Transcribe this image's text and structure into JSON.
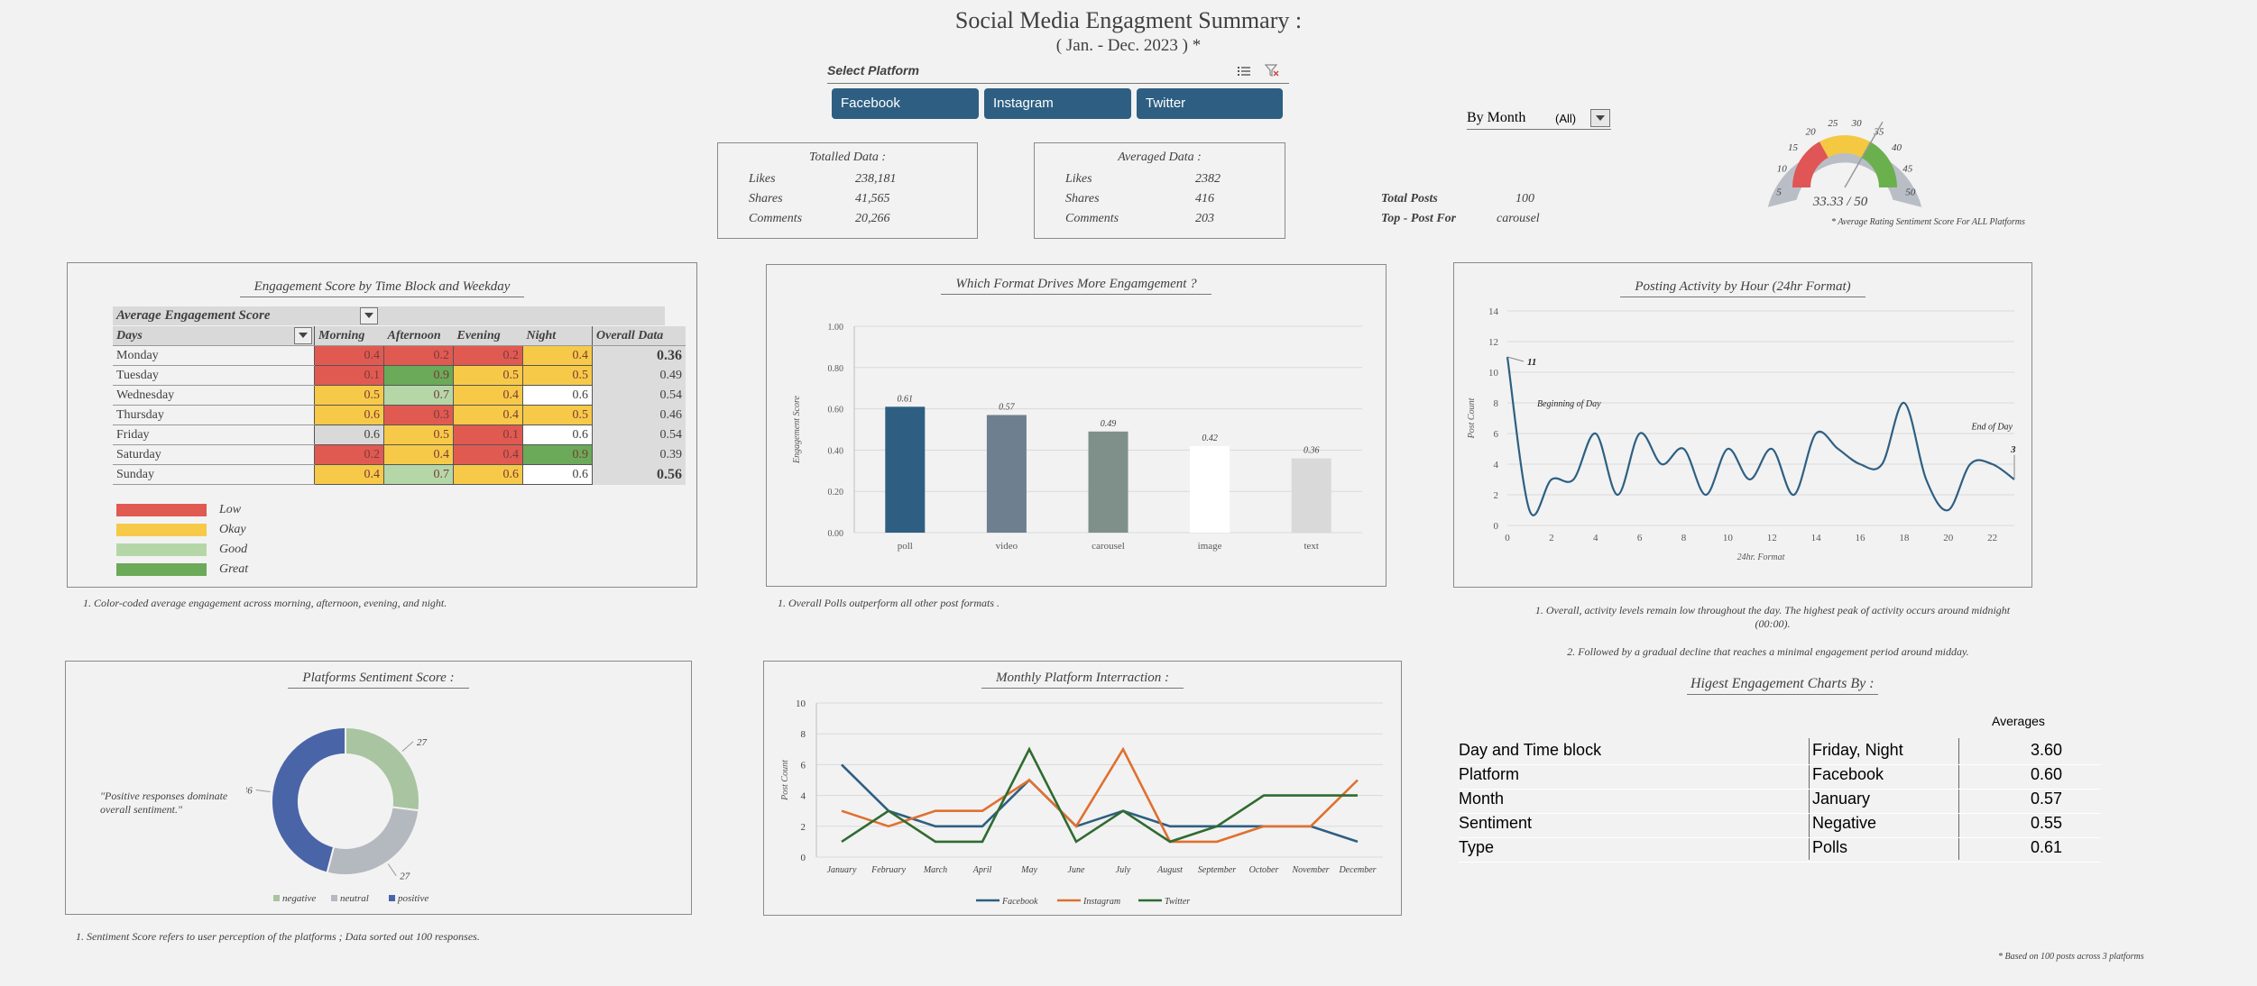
{
  "header": {
    "title": "Social  Media Engagment Summary :",
    "subtitle": "( Jan. - Dec. 2023 ) *"
  },
  "slicer": {
    "title": "Select Platform",
    "buttons": [
      "Facebook",
      "Instagram",
      "Twitter"
    ],
    "multi_select_icon": "multi-select-icon",
    "clear_filter_icon": "clear-filter-icon"
  },
  "month_filter": {
    "label": "By Month",
    "value": "(All)"
  },
  "totalled": {
    "title": "Totalled Data :",
    "rows": [
      {
        "k": "Likes",
        "v": "238,181"
      },
      {
        "k": "Shares",
        "v": "41,565"
      },
      {
        "k": "Comments",
        "v": "20,266"
      }
    ]
  },
  "averaged": {
    "title": "Averaged Data :",
    "rows": [
      {
        "k": "Likes",
        "v": "2382"
      },
      {
        "k": "Shares",
        "v": "416"
      },
      {
        "k": "Comments",
        "v": "203"
      }
    ]
  },
  "totals": {
    "posts_label": "Total Posts",
    "posts_value": "100",
    "top_label": "Top - Post For",
    "top_value": "carousel"
  },
  "gauge": {
    "value": 33.33,
    "max": 50,
    "readout": "33.33 / 50",
    "ticks": [
      "5",
      "10",
      "15",
      "20",
      "25",
      "30",
      "35",
      "40",
      "45",
      "50"
    ],
    "note": "* Average Rating  Sentiment Score For ALL Platforms",
    "colors": [
      "#e05555",
      "#f5c842",
      "#6ab04c"
    ]
  },
  "engagement": {
    "title": "Engagement Score by Time Block and Weekday",
    "avg_label": "Average  Engagement Score",
    "headers": [
      "Days",
      "Morning",
      "Afternoon",
      "Evening",
      "Night",
      "Overall Data"
    ],
    "rows": [
      {
        "day": "Monday",
        "vals": [
          "0.4",
          "0.2",
          "0.2",
          "0.4"
        ],
        "overall": "0.36"
      },
      {
        "day": "Tuesday",
        "vals": [
          "0.1",
          "0.9",
          "0.5",
          "0.5"
        ],
        "overall": "0.49"
      },
      {
        "day": "Wednesday",
        "vals": [
          "0.5",
          "0.7",
          "0.4",
          "0.6"
        ],
        "overall": "0.54"
      },
      {
        "day": "Thursday",
        "vals": [
          "0.6",
          "0.3",
          "0.4",
          "0.5"
        ],
        "overall": "0.46"
      },
      {
        "day": "Friday",
        "vals": [
          "0.6",
          "0.5",
          "0.1",
          "0.6"
        ],
        "overall": "0.54"
      },
      {
        "day": "Saturday",
        "vals": [
          "0.2",
          "0.4",
          "0.4",
          "0.9"
        ],
        "overall": "0.39"
      },
      {
        "day": "Sunday",
        "vals": [
          "0.4",
          "0.7",
          "0.6",
          "0.6"
        ],
        "overall": "0.56"
      }
    ],
    "cell_colors": [
      [
        "#e05a52",
        "#e05a52",
        "#e05a52",
        "#f7c948"
      ],
      [
        "#e05a52",
        "#6aaa58",
        "#f7c948",
        "#f7c948"
      ],
      [
        "#f7c948",
        "#b5d7a8",
        "#f7c948",
        "#ffffff"
      ],
      [
        "#f7c948",
        "#e05a52",
        "#f7c948",
        "#f7c948"
      ],
      [
        "#d9d9d9",
        "#f7c948",
        "#e05a52",
        "#ffffff"
      ],
      [
        "#e05a52",
        "#f7c948",
        "#e05a52",
        "#6aaa58"
      ],
      [
        "#f7c948",
        "#b5d7a8",
        "#f7c948",
        "#ffffff"
      ]
    ],
    "legend": [
      {
        "label": "Low",
        "color": "#e05a52"
      },
      {
        "label": "Okay",
        "color": "#f7c948"
      },
      {
        "label": "Good",
        "color": "#b5d7a8"
      },
      {
        "label": "Great",
        "color": "#6aaa58"
      }
    ],
    "note": "1. Color-coded average engagement across morning, afternoon, evening, and night."
  },
  "format_note": "1. Overall Polls  outperform all other post formats .",
  "hour_notes": [
    "1. Overall, activity levels remain low throughout the day. The highest peak of activity occurs around midnight (00:00).",
    "2. Followed by a gradual decline that reaches a minimal engagement period around midday."
  ],
  "sentiment_note": "1. Sentiment Score  refers to user perception of the platforms ;  Data sorted out  100 responses.",
  "sentiment_quote": "\"Positive responses dominate overall sentiment.\"",
  "highest": {
    "title": "Higest Engagement Charts By :",
    "col_header": "Averages",
    "rows": [
      {
        "cat": "Day and Time block",
        "val": "Friday, Night",
        "avg": "3.60"
      },
      {
        "cat": "Platform",
        "val": "Facebook",
        "avg": "0.60"
      },
      {
        "cat": "Month",
        "val": "January",
        "avg": "0.57"
      },
      {
        "cat": "Sentiment",
        "val": "Negative",
        "avg": "0.55"
      },
      {
        "cat": "Type",
        "val": "Polls",
        "avg": "0.61"
      }
    ]
  },
  "footnote": "* Based on 100 posts across 3 platforms",
  "chart_data": [
    {
      "type": "bar",
      "title": "Which  Format Drives More Engamgement ?",
      "categories": [
        "poll",
        "video",
        "carousel",
        "image",
        "text"
      ],
      "values": [
        0.61,
        0.57,
        0.49,
        0.42,
        0.36
      ],
      "data_labels": [
        "0.61",
        "0.57",
        "0.49",
        "0.42",
        "0.36"
      ],
      "colors": [
        "#2e5f82",
        "#6e7f8f",
        "#7f908a",
        "#ffffff",
        "#d9d9d9"
      ],
      "ylabel": "Engagement Score",
      "ylim": [
        0,
        1
      ],
      "yticks": [
        "0.00",
        "0.20",
        "0.40",
        "0.60",
        "0.80",
        "1.00"
      ],
      "grid": true
    },
    {
      "type": "line",
      "title": "Posting Activity by Hour (24hr Format)",
      "xlabel": "24hr. Format",
      "ylabel": "Post Count",
      "x": [
        0,
        1,
        2,
        3,
        4,
        5,
        6,
        7,
        8,
        9,
        10,
        11,
        12,
        13,
        14,
        15,
        16,
        17,
        18,
        19,
        20,
        21,
        22,
        23
      ],
      "values": [
        11,
        1,
        3,
        3,
        6,
        2,
        6,
        4,
        5,
        2,
        5,
        3,
        5,
        2,
        6,
        5,
        4,
        4,
        8,
        3,
        1,
        4,
        4,
        3
      ],
      "xlim": [
        0,
        23
      ],
      "ylim": [
        0,
        14
      ],
      "xticks": [
        "0",
        "2",
        "4",
        "6",
        "8",
        "10",
        "12",
        "14",
        "16",
        "18",
        "20",
        "22"
      ],
      "yticks": [
        "0",
        "2",
        "4",
        "6",
        "8",
        "10",
        "12",
        "14"
      ],
      "annotations": [
        "Beginning  of  Day",
        "End of Day",
        "11",
        "3"
      ],
      "color": "#2e5f82"
    },
    {
      "type": "pie",
      "title": "Platforms Sentiment Score :",
      "categories": [
        "negative",
        "neutral",
        "positive"
      ],
      "values": [
        27,
        27,
        46
      ],
      "data_labels": [
        "27",
        "27",
        "46"
      ],
      "colors": [
        "#a9c4a0",
        "#b4b8bf",
        "#4a64a8"
      ],
      "legend": "bottom"
    },
    {
      "type": "line",
      "title": "Monthly Platform Interraction :",
      "ylabel": "Post Count",
      "categories": [
        "January",
        "February",
        "March",
        "April",
        "May",
        "June",
        "July",
        "August",
        "September",
        "October",
        "November",
        "December"
      ],
      "ylim": [
        0,
        10
      ],
      "yticks": [
        "0",
        "2",
        "4",
        "6",
        "8",
        "10"
      ],
      "legend": "bottom",
      "series": [
        {
          "name": "Facebook",
          "color": "#2e5f82",
          "values": [
            6,
            3,
            2,
            2,
            5,
            2,
            3,
            2,
            2,
            2,
            2,
            1
          ]
        },
        {
          "name": "Instagram",
          "color": "#e07030",
          "values": [
            3,
            2,
            3,
            3,
            5,
            2,
            7,
            1,
            1,
            2,
            2,
            5
          ]
        },
        {
          "name": "Twitter",
          "color": "#2f6b30",
          "values": [
            1,
            3,
            1,
            1,
            7,
            1,
            3,
            1,
            2,
            4,
            4,
            4
          ]
        }
      ]
    }
  ]
}
